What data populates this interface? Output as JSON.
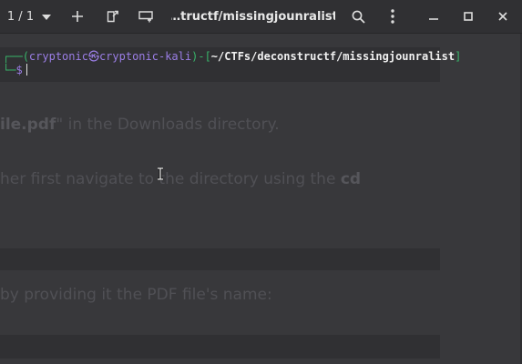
{
  "titlebar": {
    "tab_counter": "1 / 1",
    "window_title": "…tructf/missingjounralist",
    "icons": {
      "tab_menu": "chevron-down-icon",
      "new_tab": "plus-icon",
      "detach_tab": "detach-icon",
      "open_window": "window-icon",
      "search": "search-icon",
      "menu": "kebab-menu-icon",
      "minimize": "minimize-icon",
      "maximize": "maximize-icon",
      "close": "close-icon"
    }
  },
  "terminal": {
    "prompt": {
      "corner_top": "┌──",
      "open_paren": "(",
      "user_host": "cryptonic㉿cryptonic-kali",
      "close_paren": ")",
      "dash": "-",
      "open_bracket": "[",
      "path": "~/CTFs/deconstructf/missingjounralist",
      "close_bracket": "]",
      "corner_bottom": "└─",
      "dollar": "$"
    },
    "background_document": {
      "line1_bold": "ile.pdf",
      "line1_rest": "\" in the Downloads directory.",
      "line2_text": "her first navigate to the directory using the ",
      "line2_bold": "cd",
      "line3_text": "by providing it the PDF file's name:"
    }
  },
  "colors": {
    "prompt_green": "#38b56a",
    "prompt_purple": "#9b7ee6",
    "titlebar_bg": "#303033",
    "terminal_bg": "#38383b"
  }
}
